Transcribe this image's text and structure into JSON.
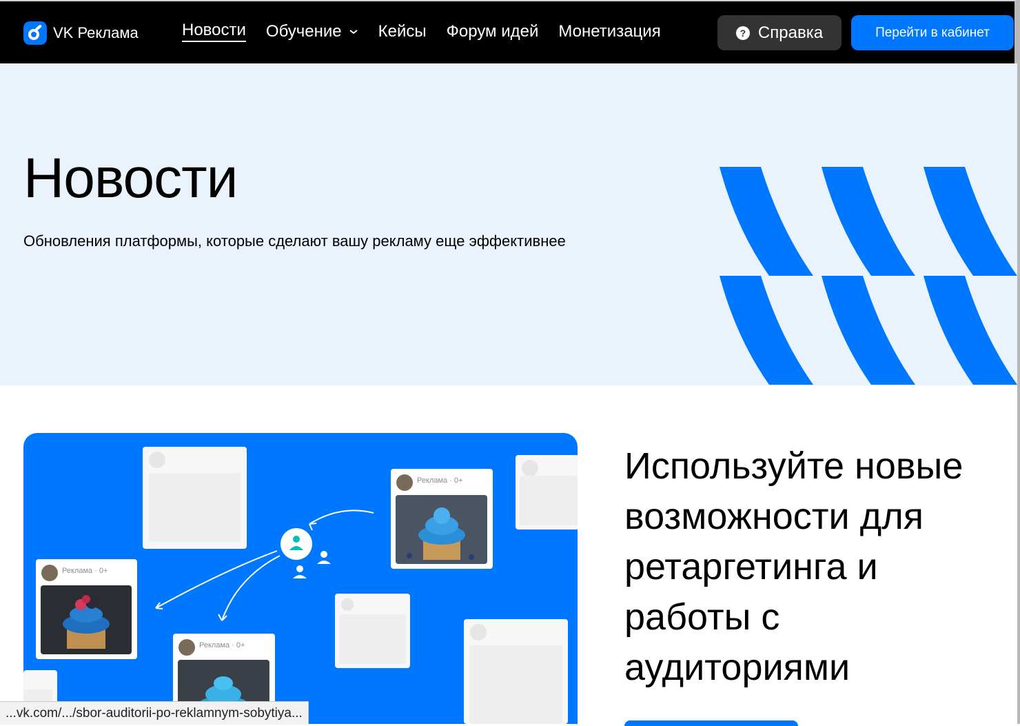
{
  "brand": {
    "name": "VK Реклама",
    "accent": "#0077ff"
  },
  "nav": {
    "items": [
      {
        "label": "Новости",
        "active": true
      },
      {
        "label": "Обучение",
        "dropdown": true
      },
      {
        "label": "Кейсы"
      },
      {
        "label": "Форум идей"
      },
      {
        "label": "Монетизация"
      }
    ],
    "help_label": "Справка",
    "cabinet_label": "Перейти в кабинет"
  },
  "hero": {
    "title": "Новости",
    "subtitle": "Обновления платформы, которые сделают вашу рекламу еще эффективнее"
  },
  "article": {
    "title": "Используйте новые возможности для ретаргетинга и работы с аудиториями",
    "ad_label": "Реклама · 0+"
  },
  "status_bar": {
    "url": "...vk.com/.../sbor-auditorii-po-reklamnym-sobytiya..."
  }
}
